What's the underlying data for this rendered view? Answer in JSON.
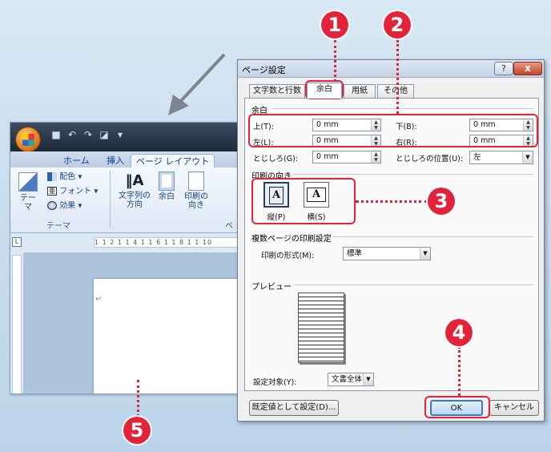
{
  "word": {
    "quick_access": [
      "■",
      "↶",
      "↷",
      "◪",
      "▾"
    ],
    "tabs": [
      "ホーム",
      "挿入",
      "ページ レイアウト"
    ],
    "ribbon": {
      "theme_label": "テーマ",
      "colors_label": "配色",
      "fonts_label": "フォント",
      "effects_label": "効果",
      "text_direction_label_1": "文字列の",
      "text_direction_label_2": "方向",
      "margins_label": "余白",
      "orientation_label_1": "印刷の",
      "orientation_label_2": "向き",
      "theme_group": "テーマ",
      "page_group_partial": "ペ"
    },
    "ruler_text": "1 1 2 1 1 4 1 1 6 1 1 8 1 1 10",
    "ruler_corner": "L",
    "para_mark": "↵"
  },
  "dialog": {
    "title": "ページ設定",
    "help": "?",
    "close": "x",
    "tabs": [
      "文字数と行数",
      "余白",
      "用紙",
      "その他"
    ],
    "margins": {
      "section": "余白",
      "top_label": "上(T):",
      "top_value": "0 mm",
      "bottom_label": "下(B):",
      "bottom_value": "0 mm",
      "left_label": "左(L):",
      "left_value": "0 mm",
      "right_label": "右(R):",
      "right_value": "0 mm",
      "gutter_label": "とじしろ(G):",
      "gutter_value": "0 mm",
      "gutter_pos_label": "とじしろの位置(U):",
      "gutter_pos_value": "左"
    },
    "orientation": {
      "section": "印刷の向き",
      "portrait": "縦(P)",
      "landscape": "横(S)"
    },
    "multiple_pages": {
      "section": "複数ページの印刷設定",
      "label": "印刷の形式(M):",
      "value": "標準"
    },
    "preview": {
      "section": "プレビュー"
    },
    "apply_to": {
      "label": "設定対象(Y):",
      "value": "文書全体"
    },
    "default_button": "既定値として設定(D)...",
    "ok_button": "OK",
    "cancel_button": "キャンセル"
  },
  "annotations": [
    "1",
    "2",
    "3",
    "4",
    "5"
  ],
  "colors": {
    "accent": "#e3233a",
    "ribbon_text": "#15428b"
  }
}
